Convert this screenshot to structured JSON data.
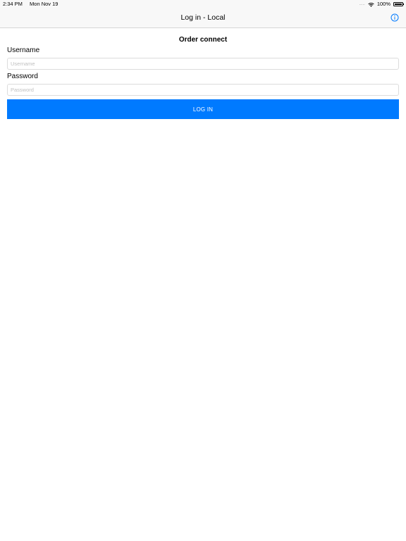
{
  "status_bar": {
    "time": "2:34 PM",
    "date": "Mon Nov 19",
    "signal": ".....",
    "battery_percent": "100%"
  },
  "nav_bar": {
    "title": "Log in - Local",
    "info_icon": "info-circle-icon"
  },
  "form": {
    "heading": "Order connect",
    "username_label": "Username",
    "username_placeholder": "Username",
    "username_value": "",
    "password_label": "Password",
    "password_placeholder": "Password",
    "password_value": "",
    "login_label": "LOG IN"
  },
  "colors": {
    "accent": "#007aff",
    "nav_background": "#f8f8f8",
    "border": "#dcdcdc"
  }
}
